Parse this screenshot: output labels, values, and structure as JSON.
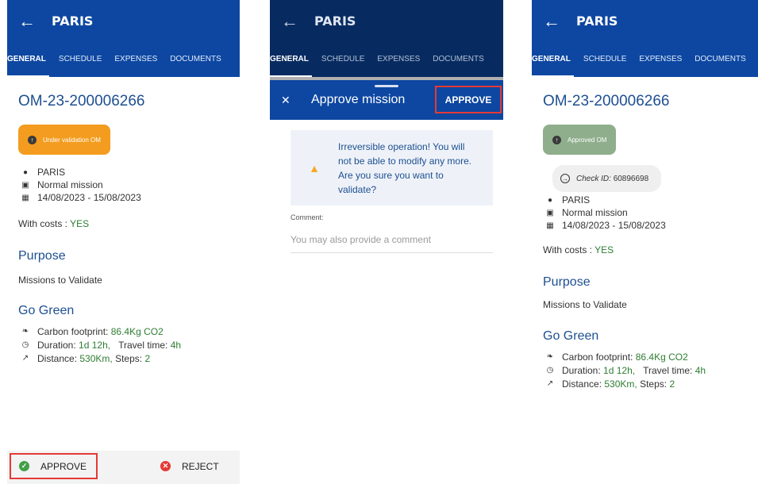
{
  "screens": {
    "details": {
      "header_title": "PARIS",
      "tabs": [
        "GENERAL",
        "SCHEDULE",
        "EXPENSES",
        "DOCUMENTS"
      ],
      "ref": "OM-23-200006266",
      "status_label": "Under validation OM",
      "location": "PARIS",
      "mission_type": "Normal mission",
      "dates": "14/08/2023 - 15/08/2023",
      "costs_label": "With costs :",
      "costs_value": "YES",
      "purpose_heading": "Purpose",
      "purpose_text": "Missions to Validate",
      "gogreen_heading": "Go Green",
      "carbon_label": "Carbon footprint:",
      "carbon_value": "86.4Kg CO2",
      "duration_label": "Duration:",
      "duration_value": "1d 12h,",
      "travel_label": "Travel time:",
      "travel_value": "4h",
      "distance_label": "Distance:",
      "distance_value": "530Km,",
      "steps_label": "Steps:",
      "steps_value": "2",
      "approve_label": "APPROVE",
      "reject_label": "REJECT"
    },
    "dialog": {
      "header_title": "PARIS",
      "tabs": [
        "GENERAL",
        "SCHEDULE",
        "EXPENSES",
        "DOCUMENTS"
      ],
      "sheet_title": "Approve mission",
      "approve_label": "APPROVE",
      "warning_text": "Irreversible operation! You will not be able to modify any more. Are you sure you want to validate?",
      "comment_label": "Comment:",
      "comment_placeholder": "You may also provide a comment"
    },
    "approved": {
      "header_title": "PARIS",
      "tabs": [
        "GENERAL",
        "SCHEDULE",
        "EXPENSES",
        "DOCUMENTS"
      ],
      "ref": "OM-23-200006266",
      "status_label": "Approved OM",
      "check_label": "Check ID:",
      "check_value": "60896698",
      "location": "PARIS",
      "mission_type": "Normal mission",
      "dates": "14/08/2023 - 15/08/2023",
      "costs_label": "With costs :",
      "costs_value": "YES",
      "purpose_heading": "Purpose",
      "purpose_text": "Missions to Validate",
      "gogreen_heading": "Go Green",
      "carbon_label": "Carbon footprint:",
      "carbon_value": "86.4Kg CO2",
      "duration_label": "Duration:",
      "duration_value": "1d 12h,",
      "travel_label": "Travel time:",
      "travel_value": "4h",
      "distance_label": "Distance:",
      "distance_value": "530Km,",
      "steps_label": "Steps:",
      "steps_value": "2"
    }
  },
  "icons": {
    "back": "arrow-left",
    "location": "map-pin",
    "mission_type": "briefcase",
    "dates": "calendar",
    "carbon": "footprint",
    "duration": "clock",
    "distance": "trend-line",
    "status": "arrow-up-circle",
    "approve": "check-circle",
    "reject": "close-circle",
    "warning": "warning-triangle",
    "check": "arrow-right-circle",
    "close": "close"
  },
  "colors": {
    "header_blue": "#0d47a1",
    "header_dimmed": "#072b61",
    "heading_blue": "#1d4f91",
    "value_green": "#2e7d32",
    "status_pending": "#f39c1f",
    "status_approved": "#8fae8c",
    "highlight_red": "#e53935",
    "warning_yellow": "#f9a825"
  }
}
